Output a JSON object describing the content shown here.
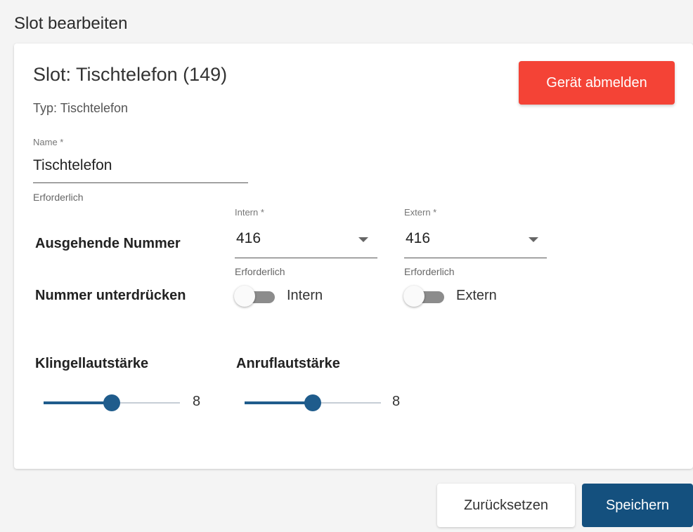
{
  "page": {
    "title": "Slot bearbeiten"
  },
  "slot": {
    "title": "Slot: Tischtelefon (149)",
    "type": "Typ: Tischtelefon",
    "unregister_label": "Gerät abmelden"
  },
  "name_field": {
    "label": "Name *",
    "value": "Tischtelefon",
    "hint": "Erforderlich"
  },
  "outgoing": {
    "label": "Ausgehende Nummer",
    "internal": {
      "label": "Intern *",
      "value": "416",
      "hint": "Erforderlich"
    },
    "external": {
      "label": "Extern *",
      "value": "416",
      "hint": "Erforderlich"
    }
  },
  "suppress": {
    "label": "Nummer unterdrücken",
    "internal": {
      "label": "Intern",
      "checked": false
    },
    "external": {
      "label": "Extern",
      "checked": false
    }
  },
  "volume": {
    "ring": {
      "label": "Klingellautstärke",
      "value": "8",
      "min": 0,
      "max": 16
    },
    "call": {
      "label": "Anruflautstärke",
      "value": "8",
      "min": 0,
      "max": 16
    }
  },
  "actions": {
    "reset_label": "Zurücksetzen",
    "save_label": "Speichern"
  },
  "colors": {
    "danger": "#f44336",
    "primary": "#14507e",
    "slider_accent": "#1f5c8c"
  }
}
